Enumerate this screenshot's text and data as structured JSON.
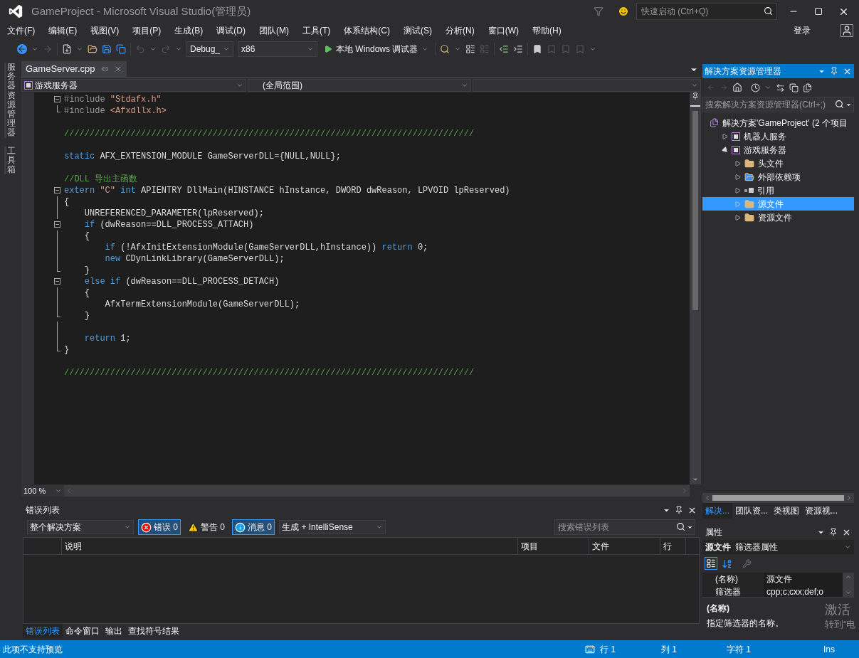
{
  "window": {
    "title": "GameProject - Microsoft Visual Studio(管理员)",
    "quick_launch": {
      "placeholder": "快速启动 (Ctrl+Q)"
    }
  },
  "menu": [
    "文件(F)",
    "编辑(E)",
    "视图(V)",
    "项目(P)",
    "生成(B)",
    "调试(D)",
    "团队(M)",
    "工具(T)",
    "体系结构(C)",
    "测试(S)",
    "分析(N)",
    "窗口(W)",
    "帮助(H)"
  ],
  "sign_in": "登录",
  "toolbar": {
    "configuration": "Debug_",
    "platform": "x86",
    "run": "本地 Windows 调试器"
  },
  "side_tabs": [
    "服务器资源管理器",
    "工具箱"
  ],
  "editor": {
    "tabs": [
      {
        "label": "GameServer.cpp",
        "selected": true
      }
    ],
    "project_combo": "游戏服务器",
    "scope_combo": "(全局范围)",
    "zoom": "100 %",
    "lines": [
      {
        "kind": "fold_open",
        "tokens": [
          {
            "kind": "pp",
            "text": "#include "
          },
          {
            "kind": "str",
            "text": "\"Stdafx.h\""
          }
        ]
      },
      {
        "kind": "fold_end",
        "tokens": [
          {
            "kind": "pp",
            "text": "#include "
          },
          {
            "kind": "str",
            "text": "<Afxdllx.h>"
          }
        ]
      },
      {
        "kind": "plain"
      },
      {
        "kind": "plain",
        "tokens": [
          {
            "kind": "cm",
            "text": "////////////////////////////////////////////////////////////////////////////////"
          }
        ]
      },
      {
        "kind": "plain"
      },
      {
        "kind": "plain",
        "tokens": [
          {
            "kind": "kw",
            "text": "static"
          },
          {
            "kind": "tx",
            "text": " AFX_EXTENSION_MODULE GameServerDLL={NULL,NULL};"
          }
        ]
      },
      {
        "kind": "plain"
      },
      {
        "kind": "plain",
        "tokens": [
          {
            "kind": "cm",
            "text": "//DLL 导出主函数"
          }
        ]
      },
      {
        "kind": "fold_open",
        "tokens": [
          {
            "kind": "kw",
            "text": "extern "
          },
          {
            "kind": "str",
            "text": "\"C\" "
          },
          {
            "kind": "kw",
            "text": "int"
          },
          {
            "kind": "tx",
            "text": " APIENTRY DllMain(HINSTANCE hInstance, DWORD dwReason, LPVOID lpReserved)"
          }
        ]
      },
      {
        "kind": "fold_line",
        "tokens": [
          {
            "kind": "tx",
            "text": "{"
          }
        ]
      },
      {
        "kind": "fold_line",
        "tokens": [
          {
            "kind": "tx",
            "text": "    UNREFERENCED_PARAMETER(lpReserved);"
          }
        ]
      },
      {
        "kind": "fold_open",
        "tokens": [
          {
            "kind": "kw",
            "text": "    if"
          },
          {
            "kind": "tx",
            "text": " (dwReason==DLL_PROCESS_ATTACH)"
          }
        ]
      },
      {
        "kind": "fold_line",
        "tokens": [
          {
            "kind": "tx",
            "text": "    {"
          }
        ]
      },
      {
        "kind": "fold_line",
        "tokens": [
          {
            "kind": "kw",
            "text": "        if"
          },
          {
            "kind": "tx",
            "text": " (!AfxInitExtensionModule(GameServerDLL,hInstance)) "
          },
          {
            "kind": "kw",
            "text": "return"
          },
          {
            "kind": "tx",
            "text": " 0;"
          }
        ]
      },
      {
        "kind": "fold_line",
        "tokens": [
          {
            "kind": "kw",
            "text": "        new"
          },
          {
            "kind": "tx",
            "text": " CDynLinkLibrary(GameServerDLL);"
          }
        ]
      },
      {
        "kind": "fold_end",
        "tokens": [
          {
            "kind": "tx",
            "text": "    }"
          }
        ]
      },
      {
        "kind": "fold_open",
        "tokens": [
          {
            "kind": "kw",
            "text": "    else if"
          },
          {
            "kind": "tx",
            "text": " (dwReason==DLL_PROCESS_DETACH)"
          }
        ]
      },
      {
        "kind": "fold_line",
        "tokens": [
          {
            "kind": "tx",
            "text": "    {"
          }
        ]
      },
      {
        "kind": "fold_line",
        "tokens": [
          {
            "kind": "tx",
            "text": "        AfxTermExtensionModule(GameServerDLL);"
          }
        ]
      },
      {
        "kind": "fold_end",
        "tokens": [
          {
            "kind": "tx",
            "text": "    }"
          }
        ]
      },
      {
        "kind": "fold_line"
      },
      {
        "kind": "fold_line",
        "tokens": [
          {
            "kind": "kw",
            "text": "    return"
          },
          {
            "kind": "tx",
            "text": " 1;"
          }
        ]
      },
      {
        "kind": "fold_end",
        "tokens": [
          {
            "kind": "tx",
            "text": "}"
          }
        ]
      },
      {
        "kind": "plain"
      },
      {
        "kind": "plain",
        "tokens": [
          {
            "kind": "cm",
            "text": "////////////////////////////////////////////////////////////////////////////////"
          }
        ]
      }
    ]
  },
  "solution_explorer": {
    "title": "解决方案资源管理器",
    "search": {
      "placeholder": "搜索解决方案资源管理器(Ctrl+;)"
    },
    "tree": [
      {
        "label": "解决方案'GameProject' (2 个项目",
        "kind": "solution",
        "selected": false,
        "children": [
          {
            "label": "机器人服务",
            "kind": "project",
            "expanded": false,
            "selected": false
          },
          {
            "label": "游戏服务器",
            "kind": "project",
            "expanded": true,
            "selected": false,
            "children": [
              {
                "label": "头文件",
                "kind": "folder",
                "expanded": false,
                "selected": false
              },
              {
                "label": "外部依赖项",
                "kind": "dependencies",
                "expanded": false,
                "selected": false
              },
              {
                "label": "引用",
                "kind": "references",
                "expanded": false,
                "selected": false
              },
              {
                "label": "源文件",
                "kind": "folder",
                "expanded": false,
                "selected": true
              },
              {
                "label": "资源文件",
                "kind": "folder",
                "expanded": false,
                "selected": false
              }
            ]
          }
        ]
      }
    ]
  },
  "panel_tabs": [
    {
      "label": "解决...",
      "selected": true
    },
    {
      "label": "团队资...",
      "selected": false
    },
    {
      "label": "类视图",
      "selected": false
    },
    {
      "label": "资源视...",
      "selected": false
    }
  ],
  "properties": {
    "title": "属性",
    "object": "源文件",
    "object_type": "筛选器属性",
    "rows": [
      {
        "name": "(名称)",
        "value": "源文件"
      },
      {
        "name": "筛选器",
        "value": "cpp;c;cxx;def;o"
      }
    ],
    "description_title": "(名称)",
    "description": "指定筛选器的名称。"
  },
  "error_list": {
    "title": "错误列表",
    "scope": "整个解决方案",
    "filters": [
      {
        "kind": "error",
        "label": "错误 0",
        "selected": true
      },
      {
        "kind": "warning",
        "label": "警告 0",
        "selected": false
      },
      {
        "kind": "message",
        "label": "消息 0",
        "selected": true
      }
    ],
    "source": "生成 + IntelliSense",
    "search": {
      "placeholder": "搜索错误列表"
    },
    "columns": [
      "说明",
      "项目",
      "文件",
      "行"
    ],
    "tabs": [
      {
        "label": "错误列表",
        "selected": true
      },
      {
        "label": "命令窗口",
        "selected": false
      },
      {
        "label": "输出",
        "selected": false
      },
      {
        "label": "查找符号结果",
        "selected": false
      }
    ]
  },
  "activation": [
    "激活",
    "转到“电"
  ],
  "status_bar": {
    "message": "此项不支持预览",
    "line": "行 1",
    "column": "列 1",
    "char": "字符 1",
    "mode": "Ins"
  }
}
